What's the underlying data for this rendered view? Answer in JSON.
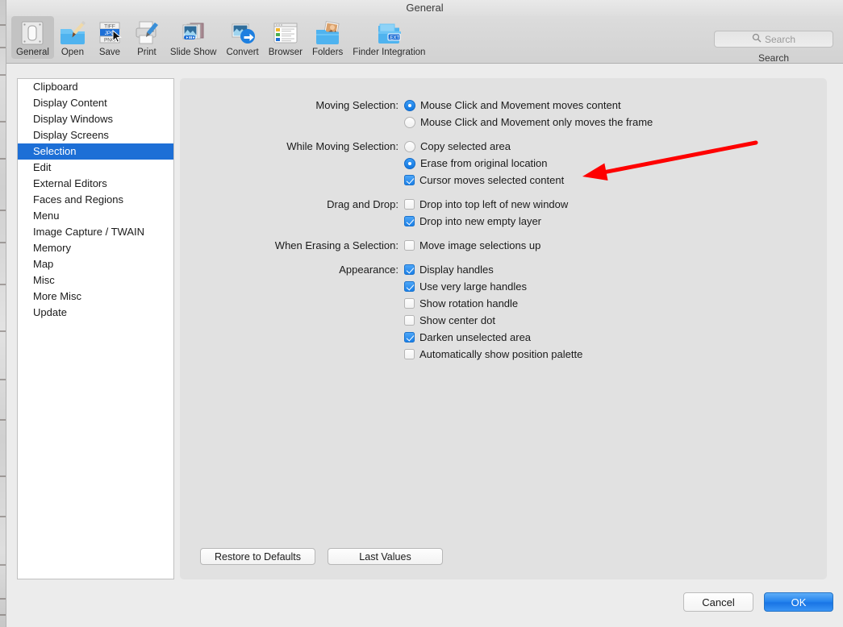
{
  "window": {
    "title": "General"
  },
  "toolbar": {
    "items": [
      {
        "label": "General",
        "icon": "general-switch-icon",
        "selected": true
      },
      {
        "label": "Open",
        "icon": "open-folder-brush-icon",
        "selected": false
      },
      {
        "label": "Save",
        "icon": "save-formats-icon",
        "selected": false
      },
      {
        "label": "Print",
        "icon": "printer-icon",
        "selected": false
      },
      {
        "label": "Slide Show",
        "icon": "slideshow-icon",
        "selected": false
      },
      {
        "label": "Convert",
        "icon": "convert-arrow-icon",
        "selected": false
      },
      {
        "label": "Browser",
        "icon": "browser-list-icon",
        "selected": false
      },
      {
        "label": "Folders",
        "icon": "folders-photo-icon",
        "selected": false
      },
      {
        "label": "Finder Integration",
        "icon": "finder-integration-ext-icon",
        "selected": false
      }
    ]
  },
  "search": {
    "placeholder": "Search",
    "value": "",
    "icon": "search-icon",
    "label": "Search"
  },
  "sidebar": {
    "items": [
      {
        "label": "Clipboard",
        "selected": false
      },
      {
        "label": "Display Content",
        "selected": false
      },
      {
        "label": "Display Windows",
        "selected": false
      },
      {
        "label": "Display Screens",
        "selected": false
      },
      {
        "label": "Selection",
        "selected": true
      },
      {
        "label": "Edit",
        "selected": false
      },
      {
        "label": "External Editors",
        "selected": false
      },
      {
        "label": "Faces and Regions",
        "selected": false
      },
      {
        "label": "Menu",
        "selected": false
      },
      {
        "label": "Image Capture / TWAIN",
        "selected": false
      },
      {
        "label": "Memory",
        "selected": false
      },
      {
        "label": "Map",
        "selected": false
      },
      {
        "label": "Misc",
        "selected": false
      },
      {
        "label": "More Misc",
        "selected": false
      },
      {
        "label": "Update",
        "selected": false
      }
    ]
  },
  "settings": {
    "groups": [
      {
        "label": "Moving Selection:",
        "controls": [
          {
            "type": "radio",
            "label": "Mouse Click and Movement moves content",
            "checked": true
          },
          {
            "type": "radio",
            "label": "Mouse Click and Movement only moves the frame",
            "checked": false
          }
        ]
      },
      {
        "label": "While Moving Selection:",
        "controls": [
          {
            "type": "radio",
            "label": "Copy selected area",
            "checked": false
          },
          {
            "type": "radio",
            "label": "Erase from original location",
            "checked": true
          },
          {
            "type": "checkbox",
            "label": "Cursor moves selected content",
            "checked": true
          }
        ]
      },
      {
        "label": "Drag and Drop:",
        "controls": [
          {
            "type": "checkbox",
            "label": "Drop into top left of new window",
            "checked": false
          },
          {
            "type": "checkbox",
            "label": "Drop into new empty layer",
            "checked": true
          }
        ]
      },
      {
        "label": "When Erasing a Selection:",
        "controls": [
          {
            "type": "checkbox",
            "label": "Move image selections up",
            "checked": false
          }
        ]
      },
      {
        "label": "Appearance:",
        "controls": [
          {
            "type": "checkbox",
            "label": "Display handles",
            "checked": true
          },
          {
            "type": "checkbox",
            "label": "Use very large handles",
            "checked": true
          },
          {
            "type": "checkbox",
            "label": "Show rotation handle",
            "checked": false
          },
          {
            "type": "checkbox",
            "label": "Show center dot",
            "checked": false
          },
          {
            "type": "checkbox",
            "label": "Darken unselected area",
            "checked": true
          },
          {
            "type": "checkbox",
            "label": "Automatically show position palette",
            "checked": false
          }
        ]
      }
    ],
    "restore_label": "Restore to Defaults",
    "last_values_label": "Last Values"
  },
  "footer": {
    "cancel_label": "Cancel",
    "ok_label": "OK",
    "ok_color": "#1f7fec"
  },
  "annotation": {
    "type": "arrow",
    "color": "#fe0000",
    "points_to": "Cursor moves selected content"
  }
}
